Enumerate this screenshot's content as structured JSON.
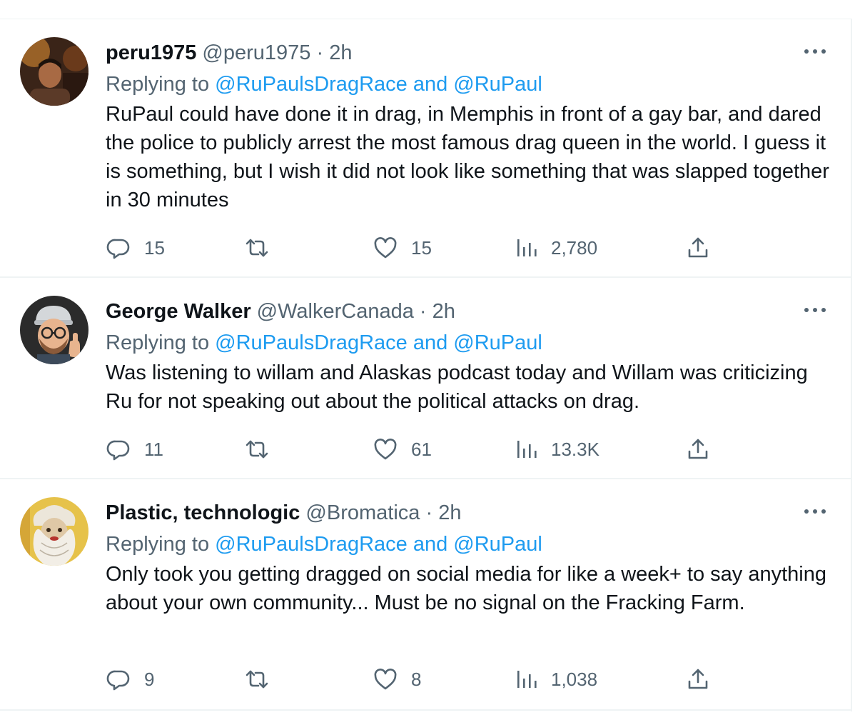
{
  "tweets": [
    {
      "name": "peru1975",
      "handle": "@peru1975",
      "dot": "·",
      "time": "2h",
      "replying_prefix": "Replying to",
      "replying_to": "@RuPaulsDragRace and @RuPaul",
      "text": "RuPaul could have done it in drag, in Memphis in front of a gay bar, and dared the police to publicly arrest the most famous drag queen in the world. I guess it is something, but I wish it did not look like something that was slapped together in 30 minutes",
      "replies": "15",
      "retweets": "",
      "likes": "15",
      "views": "2,780"
    },
    {
      "name": "George Walker",
      "handle": "@WalkerCanada",
      "dot": "·",
      "time": "2h",
      "replying_prefix": "Replying to",
      "replying_to": "@RuPaulsDragRace and @RuPaul",
      "text": "Was listening to willam and Alaskas podcast today and Willam was criticizing Ru for not speaking out about the political attacks on drag.",
      "replies": "11",
      "retweets": "",
      "likes": "61",
      "views": "13.3K"
    },
    {
      "name": "Plastic, technologic",
      "handle": "@Bromatica",
      "dot": "·",
      "time": "2h",
      "replying_prefix": "Replying to",
      "replying_to": "@RuPaulsDragRace and @RuPaul",
      "text": "Only took you getting dragged on social media for like a week+ to say anything about your own community... Must be no signal on the Fracking Farm.",
      "replies": "9",
      "retweets": "",
      "likes": "8",
      "views": "1,038"
    }
  ],
  "icons": {
    "reply": "reply-icon",
    "retweet": "retweet-icon",
    "like": "heart-icon",
    "views": "views-icon",
    "share": "share-icon",
    "more": "more-icon"
  },
  "colors": {
    "text": "#0f1419",
    "secondary": "#536471",
    "link": "#1d9bf0",
    "divider": "#eff3f4"
  }
}
